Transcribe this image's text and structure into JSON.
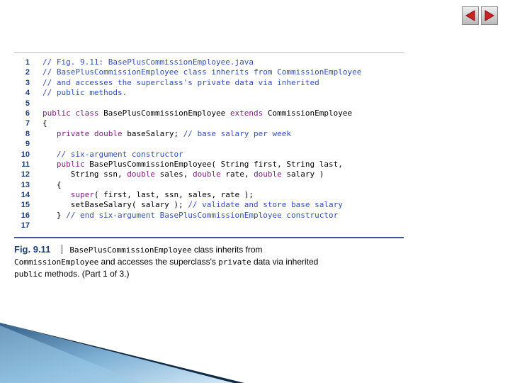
{
  "navigation": {
    "back_icon": "triangle-left",
    "forward_icon": "triangle-right",
    "accent": "#cc2222"
  },
  "code_listing": {
    "lines": [
      {
        "num": "1",
        "tokens": [
          {
            "t": "// Fig. 9.11: BasePlusCommissionEmployee.java",
            "k": "c"
          }
        ]
      },
      {
        "num": "2",
        "tokens": [
          {
            "t": "// BasePlusCommissionEmployee class inherits from CommissionEmployee",
            "k": "c"
          }
        ]
      },
      {
        "num": "3",
        "tokens": [
          {
            "t": "// and accesses the superclass's private data via inherited",
            "k": "c"
          }
        ]
      },
      {
        "num": "4",
        "tokens": [
          {
            "t": "// public methods.",
            "k": "c"
          }
        ]
      },
      {
        "num": "5",
        "tokens": []
      },
      {
        "num": "6",
        "tokens": [
          {
            "t": "public class",
            "k": "k"
          },
          {
            "t": " BasePlusCommissionEmployee ",
            "k": "p"
          },
          {
            "t": "extends",
            "k": "k"
          },
          {
            "t": " CommissionEmployee",
            "k": "p"
          }
        ]
      },
      {
        "num": "7",
        "tokens": [
          {
            "t": "{",
            "k": "p"
          }
        ]
      },
      {
        "num": "8",
        "tokens": [
          {
            "t": "   ",
            "k": "p"
          },
          {
            "t": "private double",
            "k": "k"
          },
          {
            "t": " baseSalary; ",
            "k": "p"
          },
          {
            "t": "// base salary per week",
            "k": "c"
          }
        ]
      },
      {
        "num": "9",
        "tokens": []
      },
      {
        "num": "10",
        "tokens": [
          {
            "t": "   ",
            "k": "p"
          },
          {
            "t": "// six-argument constructor",
            "k": "c"
          }
        ]
      },
      {
        "num": "11",
        "tokens": [
          {
            "t": "   ",
            "k": "p"
          },
          {
            "t": "public",
            "k": "k"
          },
          {
            "t": " BasePlusCommissionEmployee( String first, String last,",
            "k": "p"
          }
        ]
      },
      {
        "num": "12",
        "tokens": [
          {
            "t": "      String ssn, ",
            "k": "p"
          },
          {
            "t": "double",
            "k": "k"
          },
          {
            "t": " sales, ",
            "k": "p"
          },
          {
            "t": "double",
            "k": "k"
          },
          {
            "t": " rate, ",
            "k": "p"
          },
          {
            "t": "double",
            "k": "k"
          },
          {
            "t": " salary )",
            "k": "p"
          }
        ]
      },
      {
        "num": "13",
        "tokens": [
          {
            "t": "   {",
            "k": "p"
          }
        ]
      },
      {
        "num": "14",
        "tokens": [
          {
            "t": "      ",
            "k": "p"
          },
          {
            "t": "super",
            "k": "k"
          },
          {
            "t": "( first, last, ssn, sales, rate );",
            "k": "p"
          }
        ]
      },
      {
        "num": "15",
        "tokens": [
          {
            "t": "      setBaseSalary( salary ); ",
            "k": "p"
          },
          {
            "t": "// validate and store base salary",
            "k": "c"
          }
        ]
      },
      {
        "num": "16",
        "tokens": [
          {
            "t": "   } ",
            "k": "p"
          },
          {
            "t": "// end six-argument BasePlusCommissionEmployee constructor",
            "k": "c"
          }
        ]
      },
      {
        "num": "17",
        "tokens": []
      }
    ]
  },
  "caption": {
    "fig_label": "Fig. 9.11",
    "class_name": "BasePlusCommissionEmployee",
    "text1": " class inherits from",
    "superclass": "CommissionEmployee",
    "text2": " and accesses the superclass's ",
    "kw_private": "private",
    "text3": " data via inherited",
    "kw_public": "public",
    "text4": " methods. (Part 1 of 3.)"
  }
}
